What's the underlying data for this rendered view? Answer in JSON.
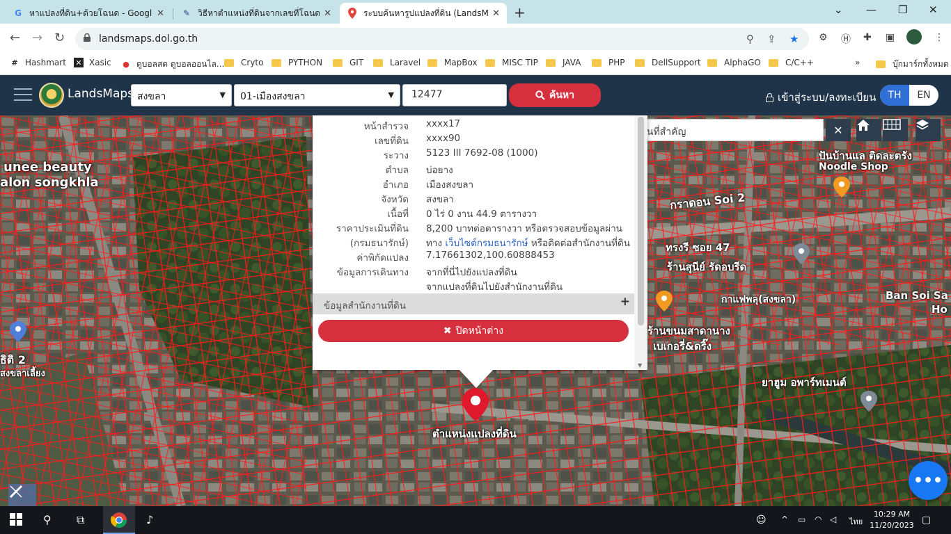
{
  "browser": {
    "tabs": [
      {
        "title": "หาแปลงที่ดิน+ด้วยโฉนด - Google S",
        "icon": "google-icon",
        "active": false
      },
      {
        "title": "วิธีหาตำแหน่งที่ดินจากเลขที่โฉนด",
        "icon": "site-icon",
        "active": false
      },
      {
        "title": "ระบบค้นหารูปแปลงที่ดิน (LandsMaps)",
        "icon": "map-pin-icon",
        "active": true
      }
    ],
    "url": "landsmaps.dol.go.th",
    "bookmarks": [
      {
        "label": "Hashmart",
        "type": "site"
      },
      {
        "label": "Xasic",
        "type": "site"
      },
      {
        "label": "ดูบอลสด ดูบอลออนไล...",
        "type": "site"
      },
      {
        "label": "Cryto",
        "type": "folder"
      },
      {
        "label": "PYTHON",
        "type": "folder"
      },
      {
        "label": "GIT",
        "type": "folder"
      },
      {
        "label": "Laravel",
        "type": "folder"
      },
      {
        "label": "MapBox",
        "type": "folder"
      },
      {
        "label": "MISC TIP",
        "type": "folder"
      },
      {
        "label": "JAVA",
        "type": "folder"
      },
      {
        "label": "PHP",
        "type": "folder"
      },
      {
        "label": "DellSupport",
        "type": "folder"
      },
      {
        "label": "AlphaGO",
        "type": "folder"
      },
      {
        "label": "C/C++",
        "type": "folder"
      }
    ],
    "bookmarks_more": "»",
    "all_bookmarks": "บุ๊กมาร์กทั้งหมด"
  },
  "app": {
    "brand": "LandsMaps",
    "province": "สงขลา",
    "district": "01-เมืองสงขลา",
    "deed_number": "12477",
    "search_label": "ค้นหา",
    "login_label": "เข้าสู่ระบบ/ลงทะเบียน",
    "lang_th": "TH",
    "lang_en": "EN"
  },
  "map": {
    "place_search_placeholder": "ค้นหาสถานที่สำคัญ",
    "pin_label": "ตำแหน่งแปลงที่ดิน",
    "labels": [
      "unee beauty",
      "alon songkhla",
      "กราดอน Soi 2",
      "ปันบ้านแล ติดละตรัง",
      "Noodle Shop",
      "ร้านสุนีย์ รัดอบรีด",
      "Ban Soi Sa",
      "Ho",
      "ร้านขนมสาดานาง",
      "เบเกอรี่&ดริ๊ง",
      "ยาฮูม อพาร์ทเมนต์",
      "ธิติ 2",
      "สงขลาเลี้ยง",
      "กาแฟพลุ(สงขลา)",
      "ทรงรี ซอย 47"
    ]
  },
  "popup": {
    "rows": [
      {
        "label": "หน้าสำรวจ",
        "value": "xxxx17"
      },
      {
        "label": "เลขที่ดิน",
        "value": "xxxx90"
      },
      {
        "label": "ระวาง",
        "value": "5123 III 7692-08 (1000)"
      },
      {
        "label": "ตำบล",
        "value": "บ่อยาง"
      },
      {
        "label": "อำเภอ",
        "value": "เมืองสงขลา"
      },
      {
        "label": "จังหวัด",
        "value": "สงขลา"
      },
      {
        "label": "เนื้อที่",
        "value": "0 ไร่ 0 งาน 44.9 ตารางวา"
      }
    ],
    "price_label_1": "ราคาประเมินที่ดิน",
    "price_label_2": "(กรมธนารักษ์)",
    "price_value_1": "8,200 บาทต่อตารางวา หรือตรวจสอบข้อมูลผ่าน",
    "price_value_2a": "ทาง ",
    "price_value_2_link": "เว็บไซต์กรมธนารักษ์",
    "price_value_2b": " หรือติดต่อสำนักงานที่ดิน",
    "coord_label": "ค่าพิกัดแปลง",
    "coord_value": "7.17661302,100.60888453",
    "travel_label": "ข้อมูลการเดินทาง",
    "travel_link_1": "จากที่นี่ไปยังแปลงที่ดิน",
    "travel_link_2": "จากแปลงที่ดินไปยังสำนักงานที่ดิน",
    "office_section": "ข้อมูลสำนักงานที่ดิน",
    "close_label": "ปิดหน้าต่าง"
  },
  "taskbar": {
    "time": "10:29 AM",
    "date": "11/20/2023",
    "lang": "ไทย"
  }
}
